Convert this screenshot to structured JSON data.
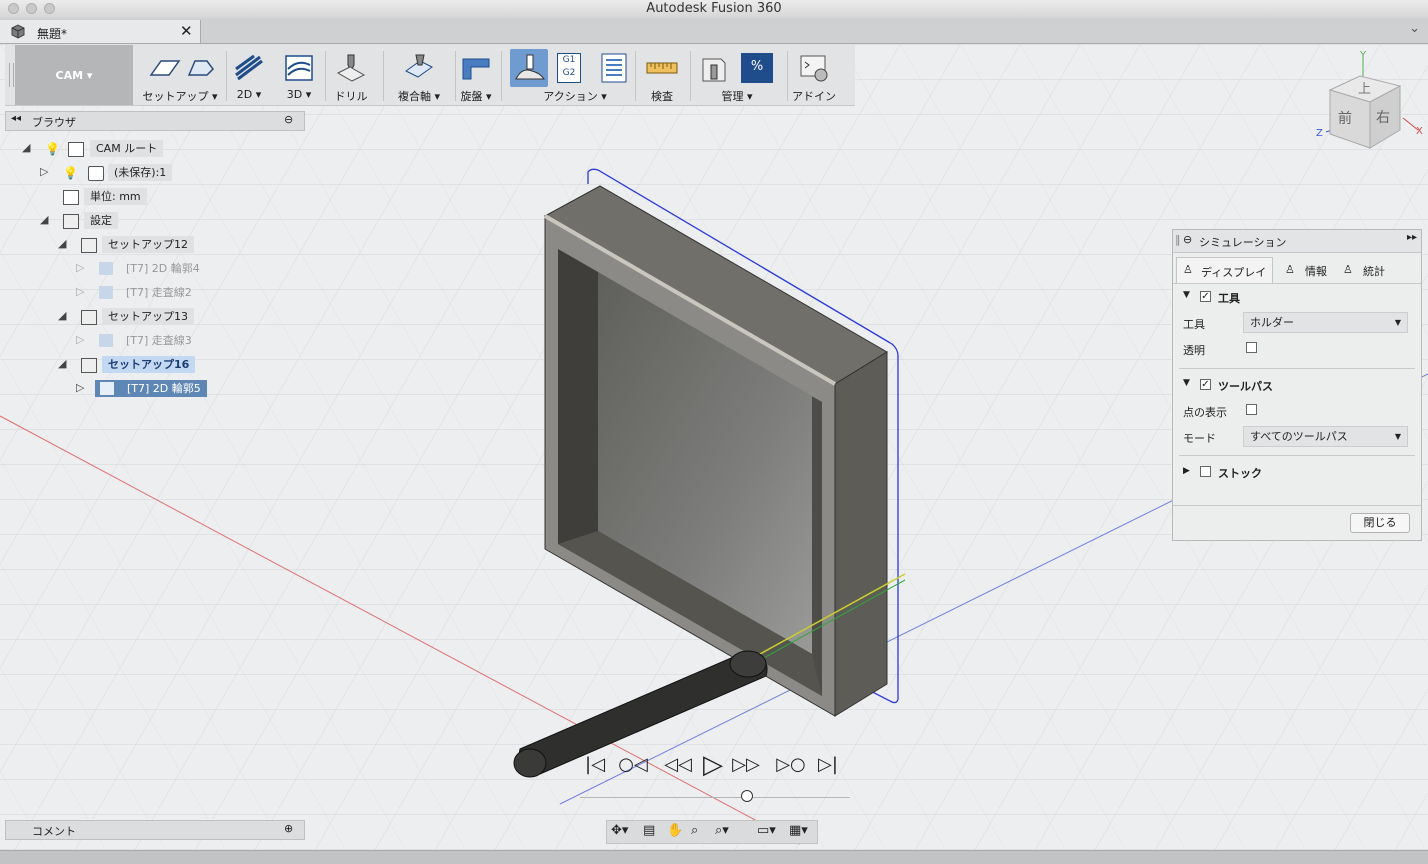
{
  "window": {
    "title": "Autodesk Fusion 360"
  },
  "document_tab": {
    "label": "無題*",
    "close": "✕"
  },
  "toolbar": {
    "workspace_label": "CAM ▾",
    "groups": [
      {
        "label": "セットアップ ▾"
      },
      {
        "label": "2D ▾"
      },
      {
        "label": "3D ▾"
      },
      {
        "label": "ドリル"
      },
      {
        "label": "複合軸 ▾"
      },
      {
        "label": "旋盤 ▾"
      },
      {
        "label": "アクション ▾"
      },
      {
        "label": "検査"
      },
      {
        "label": "管理 ▾"
      },
      {
        "label": "アドイン"
      }
    ],
    "g1g2": "G1 G2"
  },
  "browser": {
    "title": "ブラウザ",
    "nodes": [
      {
        "label": "CAM ルート"
      },
      {
        "label": "(未保存):1"
      },
      {
        "label": "単位: mm"
      },
      {
        "label": "設定"
      },
      {
        "label": "セットアップ12"
      },
      {
        "label": "[T7] 2D 輪郭4"
      },
      {
        "label": "[T7] 走査線2"
      },
      {
        "label": "セットアップ13"
      },
      {
        "label": "[T7] 走査線3"
      },
      {
        "label": "セットアップ16"
      },
      {
        "label": "[T7] 2D 輪郭5"
      }
    ]
  },
  "viewcube": {
    "top": "上",
    "front": "前",
    "right": "右",
    "x": "X",
    "y": "Y",
    "z": "Z"
  },
  "simulation": {
    "title": "シミュレーション",
    "tabs": [
      {
        "label": "ディスプレイ"
      },
      {
        "label": "情報"
      },
      {
        "label": "統計"
      }
    ],
    "tool_section": {
      "label": "工具",
      "checked": true
    },
    "tool_label": "工具",
    "tool_value": "ホルダー",
    "transparent_label": "透明",
    "toolpath_section": {
      "label": "ツールパス",
      "checked": true
    },
    "show_points_label": "点の表示",
    "mode_label": "モード",
    "mode_value": "すべてのツールパス",
    "stock_section": {
      "label": "ストック",
      "checked": false
    },
    "close_label": "閉じる"
  },
  "comment_panel": {
    "title": "コメント"
  },
  "playback": {
    "position": 0.62
  },
  "colors": {
    "accent": "#5e87b5",
    "highlight": "#c3d8f1",
    "toolpath": "#2a3adb"
  }
}
